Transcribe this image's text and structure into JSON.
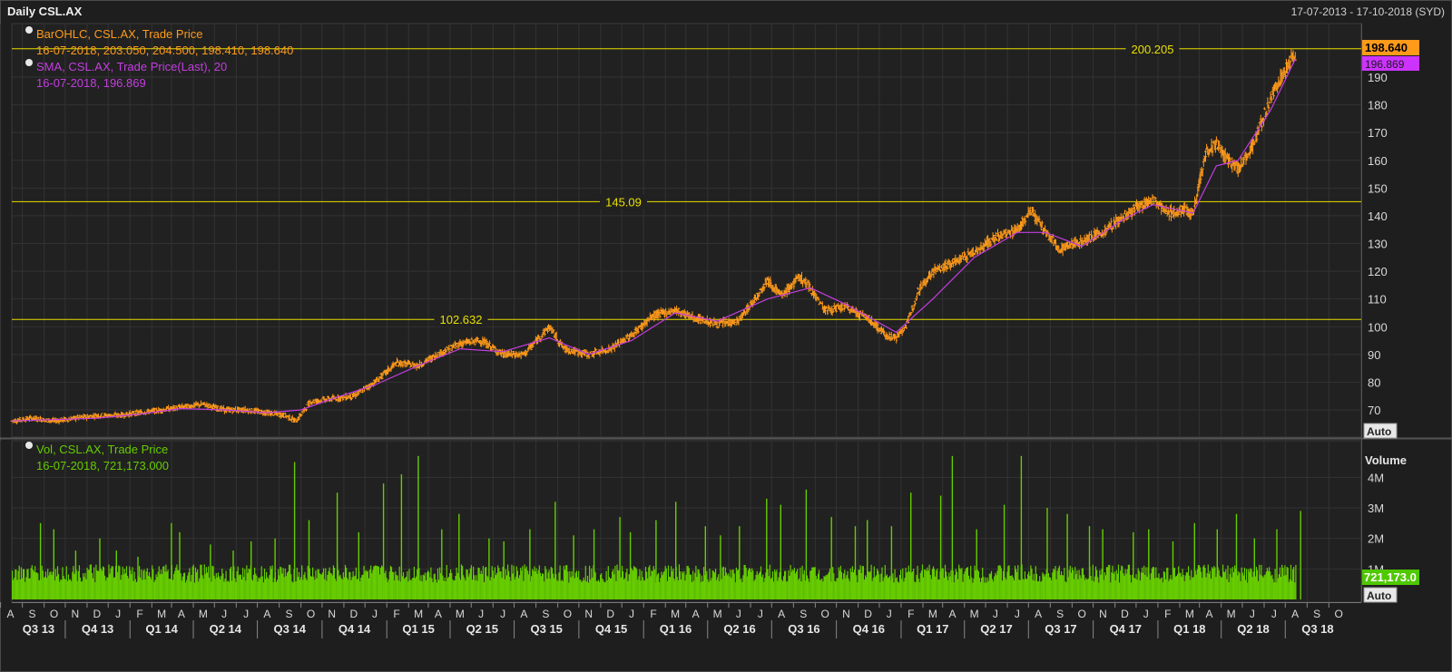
{
  "window": {
    "title": "Daily CSL.AX",
    "date_range": "17-07-2013 - 17-10-2018 (SYD)"
  },
  "legend": {
    "ohlc_name": "BarOHLC, CSL.AX, Trade Price",
    "ohlc_values": "16-07-2018, 203.050, 204.500, 198.410, 198.640",
    "sma_name": "SMA, CSL.AX, Trade Price(Last),  20",
    "sma_values": "16-07-2018, 196.869",
    "vol_name": "Vol, CSL.AX, Trade Price",
    "vol_values": "16-07-2018, 721,173.000"
  },
  "price_axis": {
    "ticks": [
      "190",
      "180",
      "170",
      "160",
      "150",
      "140",
      "130",
      "120",
      "110",
      "100",
      "90",
      "80",
      "70"
    ],
    "last_price_label": "198.640",
    "sma_label": "196.869",
    "auto_label": "Auto"
  },
  "volume_axis": {
    "title": "Volume",
    "ticks": [
      "4M",
      "3M",
      "2M",
      "1M"
    ],
    "last_volume_label": "721,173.0",
    "auto_label": "Auto"
  },
  "horizontal_lines": [
    {
      "label": "200.205"
    },
    {
      "label": "145.09"
    },
    {
      "label": "102.632"
    }
  ],
  "time_axis": {
    "months": [
      "A",
      "S",
      "O",
      "N",
      "D",
      "J",
      "F",
      "M",
      "A",
      "M",
      "J",
      "J",
      "A",
      "S",
      "O",
      "N",
      "D",
      "J",
      "F",
      "M",
      "A",
      "M",
      "J",
      "J",
      "A",
      "S",
      "O",
      "N",
      "D",
      "J",
      "F",
      "M",
      "A",
      "M",
      "J",
      "J",
      "A",
      "S",
      "O",
      "N",
      "D",
      "J",
      "F",
      "M",
      "A",
      "M",
      "J",
      "J",
      "A",
      "S",
      "O",
      "N",
      "D",
      "J",
      "F",
      "M",
      "A",
      "M",
      "J",
      "J",
      "A",
      "S",
      "O"
    ],
    "quarters": [
      "Q3 13",
      "Q4 13",
      "Q1 14",
      "Q2 14",
      "Q3 14",
      "Q4 14",
      "Q1 15",
      "Q2 15",
      "Q3 15",
      "Q4 15",
      "Q1 16",
      "Q2 16",
      "Q3 16",
      "Q4 16",
      "Q1 17",
      "Q2 17",
      "Q3 17",
      "Q4 17",
      "Q1 18",
      "Q2 18",
      "Q3 18"
    ]
  },
  "colors": {
    "background": "#1e1e1e",
    "grid": "#333333",
    "ohlc": "#ff9a1a",
    "sma": "#c33ee0",
    "volume": "#66cc00",
    "hline": "#e8e000",
    "price_tag_bg": "#ff9a1a",
    "sma_tag_bg": "#cc33ff",
    "volume_tag_bg": "#4fc800"
  },
  "chart_data": {
    "type": "line",
    "title": "Daily CSL.AX",
    "series": [
      {
        "name": "BarOHLC, CSL.AX, Trade Price",
        "x": [
          "2013-07-17",
          "2013-08-15",
          "2013-09-15",
          "2013-10-15",
          "2013-11-15",
          "2013-12-15",
          "2014-01-15",
          "2014-02-15",
          "2014-03-15",
          "2014-04-15",
          "2014-05-15",
          "2014-06-15",
          "2014-07-15",
          "2014-08-10",
          "2014-08-25",
          "2014-09-15",
          "2014-10-15",
          "2014-11-15",
          "2014-12-15",
          "2015-01-15",
          "2015-02-15",
          "2015-03-15",
          "2015-04-15",
          "2015-05-15",
          "2015-06-15",
          "2015-07-15",
          "2015-08-20",
          "2015-09-10",
          "2015-10-15",
          "2015-11-15",
          "2015-12-15",
          "2016-01-15",
          "2016-02-15",
          "2016-03-15",
          "2016-04-15",
          "2016-05-15",
          "2016-06-10",
          "2016-06-25",
          "2016-07-15",
          "2016-08-10",
          "2016-08-25",
          "2016-09-15",
          "2016-10-15",
          "2016-11-15",
          "2016-12-10",
          "2016-12-25",
          "2017-01-10",
          "2017-01-25",
          "2017-02-15",
          "2017-03-15",
          "2017-04-15",
          "2017-05-15",
          "2017-06-15",
          "2017-07-05",
          "2017-07-25",
          "2017-08-15",
          "2017-09-15",
          "2017-10-15",
          "2017-11-15",
          "2017-12-10",
          "2017-12-25",
          "2018-01-15",
          "2018-02-05",
          "2018-02-20",
          "2018-03-10",
          "2018-03-25",
          "2018-04-10",
          "2018-04-25",
          "2018-05-15",
          "2018-06-10",
          "2018-06-25",
          "2018-07-16"
        ],
        "values": [
          66,
          67,
          66,
          67,
          68,
          68,
          69,
          70,
          71,
          72,
          70,
          70,
          69,
          68,
          66,
          73,
          74,
          75,
          80,
          87,
          86,
          90,
          94,
          95,
          90,
          90,
          100,
          92,
          90,
          92,
          97,
          104,
          106,
          103,
          101,
          102,
          111,
          117,
          111,
          118,
          114,
          106,
          107,
          103,
          97,
          96,
          101,
          113,
          120,
          123,
          127,
          132,
          135,
          142,
          134,
          128,
          131,
          134,
          140,
          144,
          146,
          141,
          142,
          141,
          163,
          166,
          160,
          157,
          165,
          182,
          190,
          198.64
        ]
      },
      {
        "name": "SMA, CSL.AX, Trade Price(Last),  20",
        "x": [
          "2013-07-17",
          "2013-09-15",
          "2013-11-15",
          "2014-01-15",
          "2014-03-15",
          "2014-05-15",
          "2014-07-15",
          "2014-09-01",
          "2014-10-15",
          "2014-12-15",
          "2015-02-15",
          "2015-04-15",
          "2015-06-15",
          "2015-08-20",
          "2015-10-15",
          "2015-12-15",
          "2016-02-15",
          "2016-04-15",
          "2016-06-25",
          "2016-08-25",
          "2016-10-15",
          "2016-12-25",
          "2017-02-15",
          "2017-04-15",
          "2017-06-15",
          "2017-07-25",
          "2017-09-15",
          "2017-11-15",
          "2017-12-25",
          "2018-02-20",
          "2018-03-25",
          "2018-04-25",
          "2018-06-10",
          "2018-07-16"
        ],
        "values": [
          66,
          66.5,
          67,
          68.5,
          70.5,
          70,
          69,
          70,
          74,
          79,
          86,
          92,
          91,
          96,
          90,
          95,
          105,
          102,
          110,
          114,
          108,
          98,
          110,
          125,
          134,
          134,
          129,
          139,
          144,
          141,
          158,
          160,
          178,
          196.869
        ]
      },
      {
        "name": "Vol, CSL.AX, Trade Price",
        "x": [
          "2013-08",
          "2013-09",
          "2013-10",
          "2013-11",
          "2013-12",
          "2014-01",
          "2014-02",
          "2014-03",
          "2014-04",
          "2014-05",
          "2014-06",
          "2014-07",
          "2014-08",
          "2014-09",
          "2014-10",
          "2014-11",
          "2014-12",
          "2015-01",
          "2015-02",
          "2015-03",
          "2015-04",
          "2015-05",
          "2015-06",
          "2015-07",
          "2015-08",
          "2015-09",
          "2015-10",
          "2015-11",
          "2015-12",
          "2016-01",
          "2016-02",
          "2016-03",
          "2016-04",
          "2016-05",
          "2016-06",
          "2016-07",
          "2016-08",
          "2016-09",
          "2016-10",
          "2016-11",
          "2016-12",
          "2017-01",
          "2017-02",
          "2017-03",
          "2017-04",
          "2017-05",
          "2017-06",
          "2017-07",
          "2017-08",
          "2017-09",
          "2017-10",
          "2017-11",
          "2017-12",
          "2018-01",
          "2018-02",
          "2018-03",
          "2018-04",
          "2018-05",
          "2018-06",
          "2018-07"
        ],
        "values": [
          2.5,
          2.3,
          1.6,
          2.0,
          1.6,
          1.4,
          2.5,
          2.2,
          1.8,
          1.6,
          1.9,
          2.0,
          4.5,
          2.6,
          3.5,
          2.2,
          3.8,
          4.1,
          4.7,
          2.3,
          2.8,
          2.0,
          1.9,
          2.3,
          3.2,
          2.1,
          2.3,
          2.7,
          2.2,
          2.6,
          3.2,
          2.4,
          2.1,
          2.4,
          3.3,
          3.1,
          3.6,
          2.7,
          2.4,
          2.6,
          2.4,
          3.5,
          3.4,
          4.7,
          2.3,
          3.1,
          4.7,
          3.0,
          2.8,
          2.4,
          2.3,
          2.2,
          2.3,
          1.9,
          2.5,
          2.3,
          2.8,
          2.0,
          2.3,
          2.9
        ]
      }
    ],
    "horizontal_lines": [
      200.205,
      145.09,
      102.632
    ],
    "price_range": [
      63,
      205
    ],
    "volume_range": [
      0,
      4.8
    ],
    "volume_unit": "M",
    "grid": true
  }
}
